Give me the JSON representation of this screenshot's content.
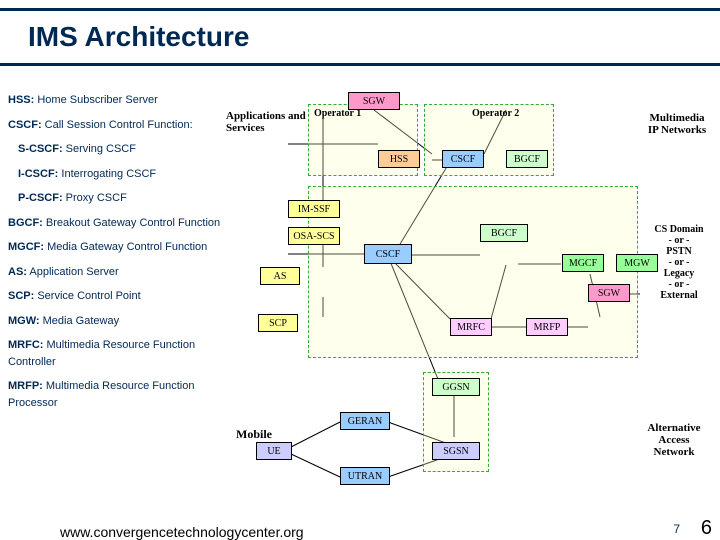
{
  "title": "IMS Architecture",
  "legend": [
    {
      "abbr": "HSS:",
      "text": "Home Subscriber Server",
      "sub": false,
      "link": true
    },
    {
      "abbr": "CSCF:",
      "text": "Call Session Control Function:",
      "sub": false,
      "link": true
    },
    {
      "abbr": "S-CSCF:",
      "text": "Serving CSCF",
      "sub": true,
      "link": false
    },
    {
      "abbr": "I-CSCF:",
      "text": "Interrogating CSCF",
      "sub": true,
      "link": false
    },
    {
      "abbr": "P-CSCF:",
      "text": "Proxy CSCF",
      "sub": true,
      "link": false
    },
    {
      "abbr": "BGCF:",
      "text": "Breakout Gateway Control Function",
      "sub": false,
      "link": true
    },
    {
      "abbr": "MGCF:",
      "text": "Media Gateway Control Function",
      "sub": false,
      "link": true
    },
    {
      "abbr": "AS:",
      "text": "Application Server",
      "sub": false,
      "link": true
    },
    {
      "abbr": "SCP:",
      "text": "Service Control Point",
      "sub": false,
      "link": true
    },
    {
      "abbr": "MGW:",
      "text": "Media Gateway",
      "sub": false,
      "link": true
    },
    {
      "abbr": "MRFC:",
      "text": "Multimedia Resource Function Controller",
      "sub": false,
      "link": true
    },
    {
      "abbr": "MRFP:",
      "text": "Multimedia Resource Function Processor",
      "sub": false,
      "link": true
    }
  ],
  "sections": {
    "apps": "Applications and Services",
    "mobile": "Mobile",
    "mmip": "Multimedia IP Networks",
    "cs": "CS Domain\n- or -\nPSTN\n- or -\nLegacy\n- or -\nExternal",
    "alt": "Alternative Access Network"
  },
  "operators": {
    "op1": "Operator 1",
    "op2": "Operator 2"
  },
  "nodes": {
    "sgw1": "SGW",
    "hss": "HSS",
    "cscf1": "CSCF",
    "bgcf1": "BGCF",
    "imssf": "IM-SSF",
    "osascs": "OSA-SCS",
    "as": "AS",
    "scp": "SCP",
    "cscf2": "CSCF",
    "bgcf2": "BGCF",
    "mgcf": "MGCF",
    "mgw": "MGW",
    "sgw2": "SGW",
    "mrfc": "MRFC",
    "mrfp": "MRFP",
    "ue": "UE",
    "geran": "GERAN",
    "utran": "UTRAN",
    "ggsn": "GGSN",
    "sgsn": "SGSN"
  },
  "footer": {
    "url": "www.convergencetechnologycenter.org",
    "page7": "7",
    "page6": "6"
  }
}
